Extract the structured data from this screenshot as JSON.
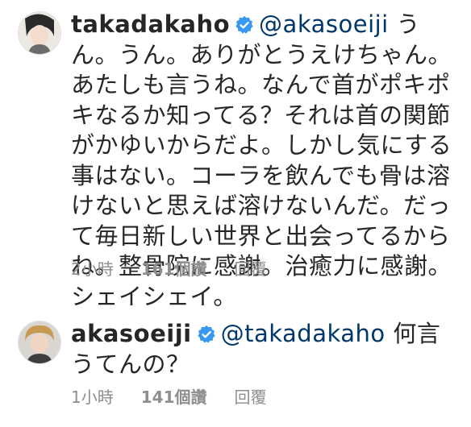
{
  "comments": [
    {
      "username": "takadakaho",
      "verified": true,
      "mention": "@akasoeiji",
      "text": "うん。うん。ありがとうえけちゃん。あたしも言うね。なんで首がポキポキなるか知ってる？それは首の関節がかゆいからだよ。しかし気にする事はない。コーラを飲んでも骨は溶けないと思えば溶けないんだ。だって毎日新しい世界と出会ってるからね。整骨院に感謝。治癒力に感謝。シェイシェイ。",
      "time": "2小時",
      "likes": "161個讚",
      "reply_label": "回覆"
    },
    {
      "username": "akasoeiji",
      "verified": true,
      "mention": "@takadakaho",
      "text": "何言うてんの？",
      "time": "1小時",
      "likes": "141個讚",
      "reply_label": "回覆"
    }
  ],
  "colors": {
    "verified_badge": "#3897f0",
    "mention": "#00376b",
    "meta_text": "#8e8e8e"
  },
  "icons": [
    "user-avatar",
    "verified-badge-icon"
  ]
}
